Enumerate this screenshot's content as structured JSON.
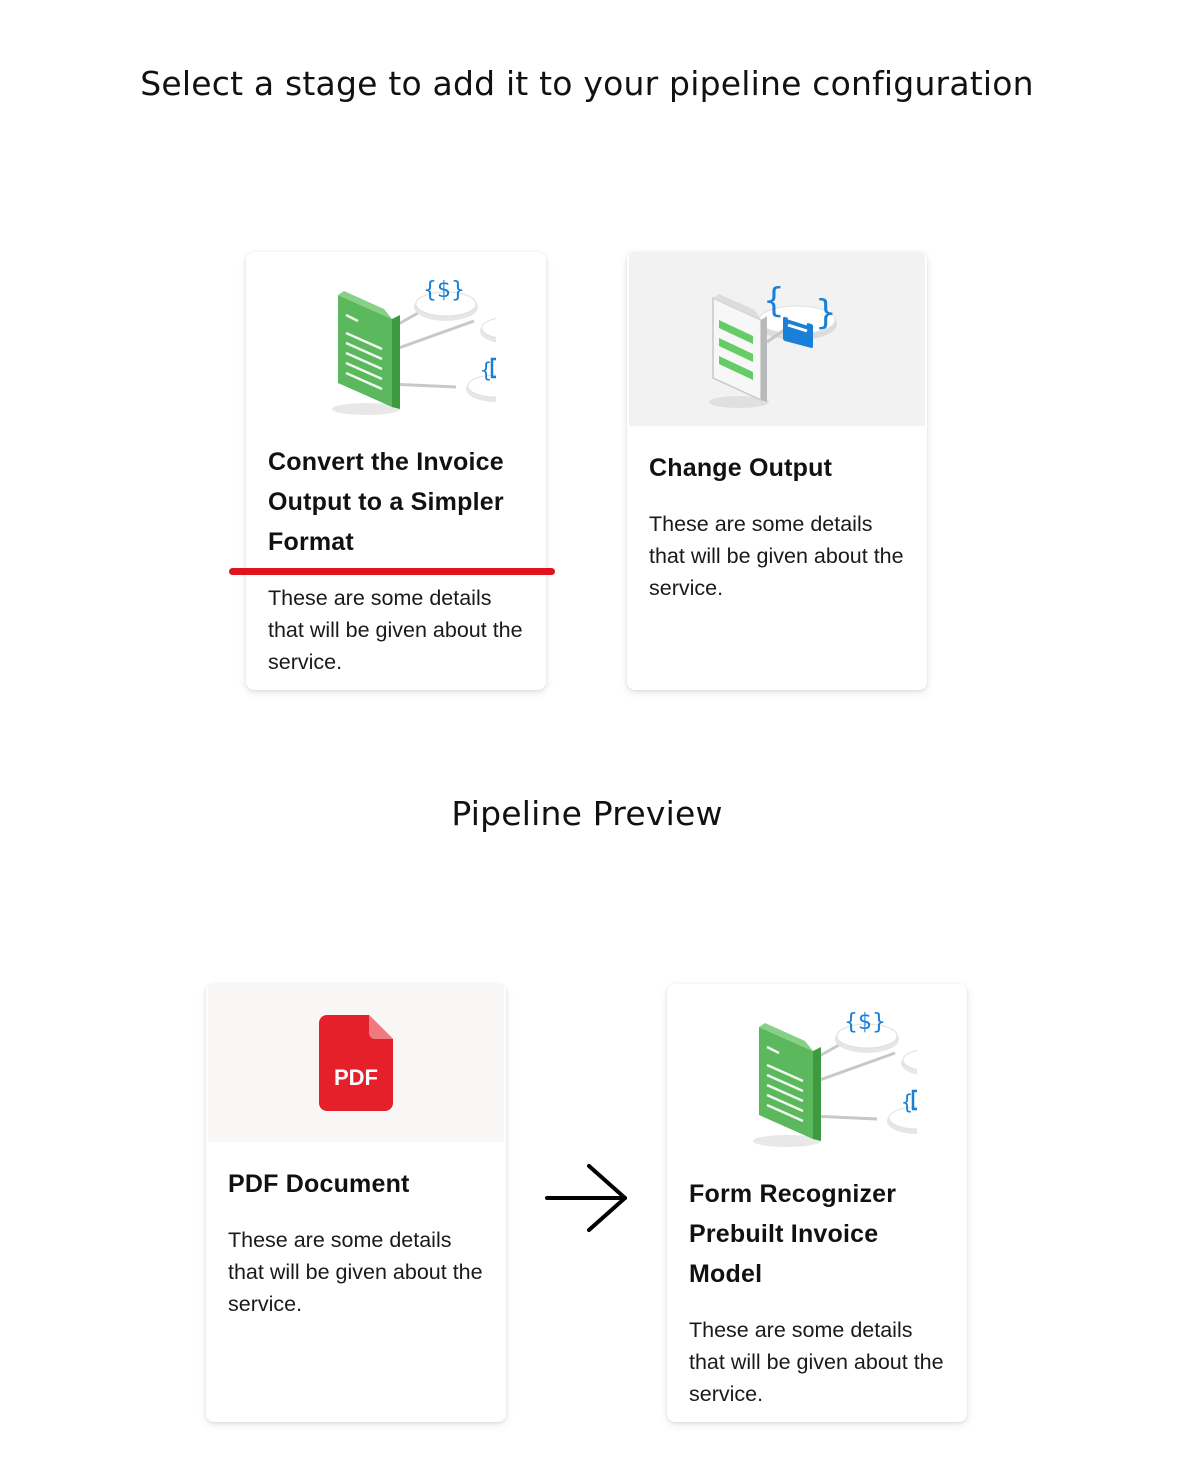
{
  "page": {
    "title": "Select a stage to add it to your pipeline configuration"
  },
  "stages": [
    {
      "title": "Convert the Invoice Output to a Simpler Format",
      "description": "These are some details that will be given about the service.",
      "icon": "invoice-data-icon",
      "highlighted": true,
      "highlight_color": "#e0141e"
    },
    {
      "title": "Change Output",
      "description": "These are some details that will be given about the service.",
      "icon": "document-output-icon"
    }
  ],
  "preview": {
    "title": "Pipeline Preview",
    "steps": [
      {
        "title": "PDF Document",
        "description": "These are some details that will be given about the service.",
        "icon": "pdf-icon",
        "icon_label": "PDF",
        "icon_color": "#e5202b"
      },
      {
        "title": "Form Recognizer Prebuilt Invoice Model",
        "description": "These are some details that will be given about the service.",
        "icon": "invoice-data-icon"
      }
    ],
    "connector_icon": "arrow-right-icon"
  },
  "colors": {
    "accent_blue": "#1a7fd6",
    "doc_green": "#5cb85c",
    "highlight_red": "#e0141e"
  }
}
